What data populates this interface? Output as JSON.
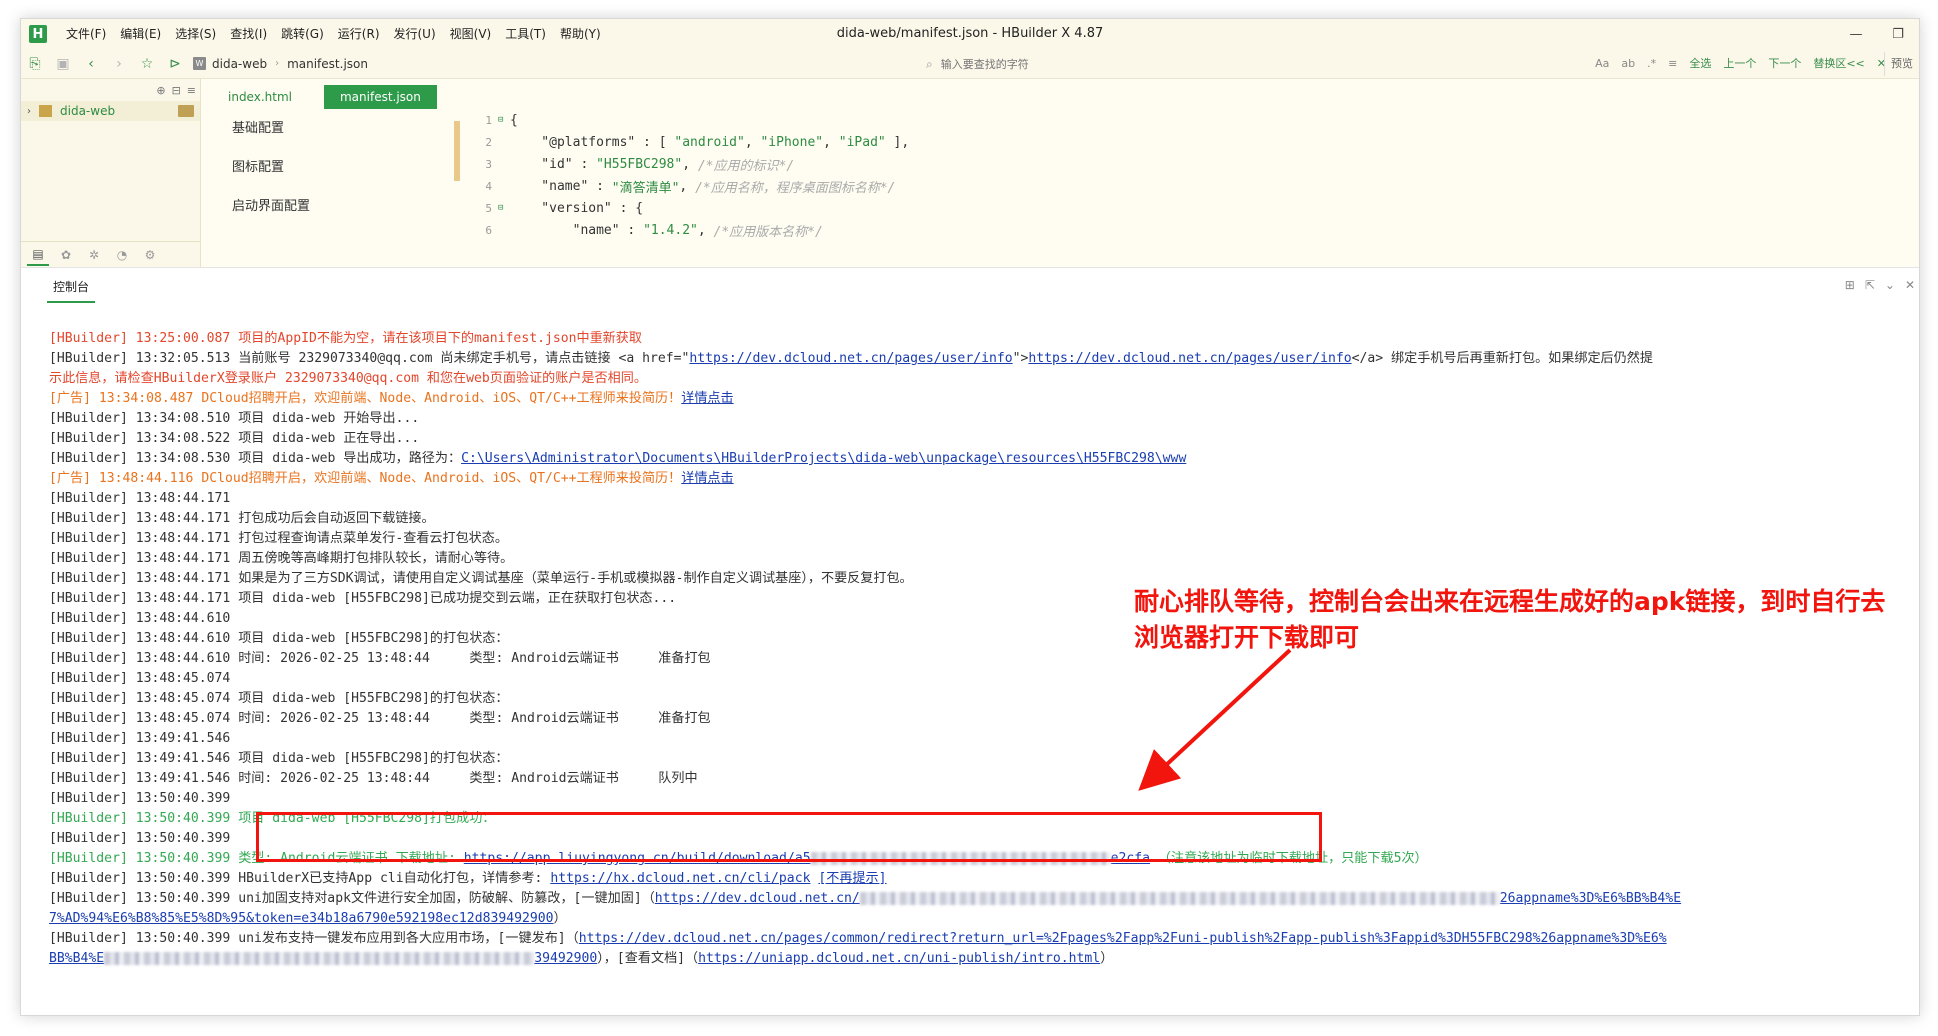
{
  "app": {
    "logo": "H",
    "title": "dida-web/manifest.json - HBuilder X 4.87",
    "menu": [
      "文件(F)",
      "编辑(E)",
      "选择(S)",
      "查找(I)",
      "跳转(G)",
      "运行(R)",
      "发行(U)",
      "视图(V)",
      "工具(T)",
      "帮助(Y)"
    ],
    "controls": {
      "minimize": "—",
      "restore": "❐"
    }
  },
  "toolbar": {
    "breadcrumb": [
      "dida-web",
      "manifest.json"
    ],
    "search_placeholder": "输入要查找的字符",
    "find_tools": [
      "Aa",
      "ab",
      ".*",
      "≡",
      "全选",
      "上一个",
      "下一个",
      "替换区<<",
      "✕"
    ],
    "preview": "预览"
  },
  "project": {
    "root": "dida-web"
  },
  "editor": {
    "tabs": [
      {
        "label": "index.html",
        "active": false
      },
      {
        "label": "manifest.json",
        "active": true
      }
    ],
    "config_nav": [
      "基础配置",
      "图标配置",
      "启动界面配置"
    ],
    "code_lines": [
      {
        "n": "1",
        "fold": "⊟",
        "parts": [
          {
            "t": "{",
            "c": "k"
          }
        ]
      },
      {
        "n": "2",
        "fold": "",
        "parts": [
          {
            "t": "    \"@platforms\" : [ ",
            "c": "k"
          },
          {
            "t": "\"android\"",
            "c": "s"
          },
          {
            "t": ", ",
            "c": "k"
          },
          {
            "t": "\"iPhone\"",
            "c": "s"
          },
          {
            "t": ", ",
            "c": "k"
          },
          {
            "t": "\"iPad\"",
            "c": "s"
          },
          {
            "t": " ],",
            "c": "k"
          }
        ]
      },
      {
        "n": "3",
        "fold": "",
        "parts": [
          {
            "t": "    \"id\" : ",
            "c": "k"
          },
          {
            "t": "\"H55FBC298\"",
            "c": "s"
          },
          {
            "t": ", ",
            "c": "k"
          },
          {
            "t": "/*应用的标识*/",
            "c": "c"
          }
        ]
      },
      {
        "n": "4",
        "fold": "",
        "parts": [
          {
            "t": "    \"name\" : ",
            "c": "k"
          },
          {
            "t": "\"滴答清单\"",
            "c": "s"
          },
          {
            "t": ", ",
            "c": "k"
          },
          {
            "t": "/*应用名称，程序桌面图标名称*/",
            "c": "c"
          }
        ]
      },
      {
        "n": "5",
        "fold": "⊟",
        "parts": [
          {
            "t": "    \"version\" : {",
            "c": "k"
          }
        ]
      },
      {
        "n": "6",
        "fold": "",
        "parts": [
          {
            "t": "        \"name\" : ",
            "c": "k"
          },
          {
            "t": "\"1.4.2\"",
            "c": "s"
          },
          {
            "t": ", ",
            "c": "k"
          },
          {
            "t": "/*应用版本名称*/",
            "c": "c"
          }
        ]
      }
    ]
  },
  "console": {
    "tab": "控制台",
    "lines": [
      {
        "cls": "red",
        "parts": [
          {
            "t": "[HBuilder] 13:25:00.087 项目的AppID不能为空，请在该项目下的manifest.json中重新获取"
          }
        ]
      },
      {
        "cls": "",
        "parts": [
          {
            "t": "[HBuilder] 13:32:05.513 "
          },
          {
            "t": "当前账号 2329073340@qq.com 尚未绑定手机号，请点击链接 <a href=\"",
            "cls": "red"
          },
          {
            "t": "https://dev.dcloud.net.cn/pages/user/info",
            "link": true
          },
          {
            "t": "\">",
            "cls": "red"
          },
          {
            "t": "https://dev.dcloud.net.cn/pages/user/info",
            "link": true
          },
          {
            "t": "</a> 绑定手机号后再重新打包。如果绑定后仍然提",
            "cls": "red"
          }
        ]
      },
      {
        "cls": "red",
        "parts": [
          {
            "t": "示此信息，请检查HBuilderX登录账户 2329073340@qq.com 和您在web页面验证的账户是否相同。"
          }
        ]
      },
      {
        "cls": "orange",
        "parts": [
          {
            "t": "[广告] 13:34:08.487 DCloud招聘开启，欢迎前端、Node、Android、iOS、QT/C++工程师来投简历！"
          },
          {
            "t": "详情点击",
            "link": true
          }
        ]
      },
      {
        "cls": "",
        "parts": [
          {
            "t": "[HBuilder] 13:34:08.510 项目 dida-web 开始导出..."
          }
        ]
      },
      {
        "cls": "",
        "parts": [
          {
            "t": "[HBuilder] 13:34:08.522 项目 dida-web 正在导出..."
          }
        ]
      },
      {
        "cls": "",
        "parts": [
          {
            "t": "[HBuilder] 13:34:08.530 "
          },
          {
            "t": "项目 dida-web 导出成功，路径为：",
            "cls": "orange"
          },
          {
            "t": "C:\\Users\\Administrator\\Documents\\HBuilderProjects\\dida-web\\unpackage\\resources\\H55FBC298\\www",
            "link": true
          }
        ]
      },
      {
        "cls": "orange",
        "parts": [
          {
            "t": "[广告] 13:48:44.116 DCloud招聘开启，欢迎前端、Node、Android、iOS、QT/C++工程师来投简历！"
          },
          {
            "t": "详情点击",
            "link": true
          }
        ]
      },
      {
        "cls": "",
        "parts": [
          {
            "t": "[HBuilder] 13:48:44.171"
          }
        ]
      },
      {
        "cls": "",
        "parts": [
          {
            "t": "[HBuilder] 13:48:44.171 打包成功后会自动返回下载链接。"
          }
        ]
      },
      {
        "cls": "",
        "parts": [
          {
            "t": "[HBuilder] 13:48:44.171 打包过程查询请点菜单发行-查看云打包状态。"
          }
        ]
      },
      {
        "cls": "",
        "parts": [
          {
            "t": "[HBuilder] 13:48:44.171 周五傍晚等高峰期打包排队较长，请耐心等待。"
          }
        ]
      },
      {
        "cls": "",
        "parts": [
          {
            "t": "[HBuilder] 13:48:44.171 如果是为了三方SDK调试，请使用自定义调试基座（菜单运行-手机或模拟器-制作自定义调试基座），不要反复打包。"
          }
        ]
      },
      {
        "cls": "",
        "parts": [
          {
            "t": "[HBuilder] 13:48:44.171 项目 dida-web [H55FBC298]已成功提交到云端，正在获取打包状态..."
          }
        ]
      },
      {
        "cls": "",
        "parts": [
          {
            "t": "[HBuilder] 13:48:44.610"
          }
        ]
      },
      {
        "cls": "",
        "parts": [
          {
            "t": "[HBuilder] 13:48:44.610 项目 dida-web [H55FBC298]的打包状态："
          }
        ]
      },
      {
        "cls": "",
        "parts": [
          {
            "t": "[HBuilder] 13:48:44.610 时间: 2026-02-25 13:48:44     类型: Android云端证书     准备打包"
          }
        ]
      },
      {
        "cls": "",
        "parts": [
          {
            "t": "[HBuilder] 13:48:45.074"
          }
        ]
      },
      {
        "cls": "",
        "parts": [
          {
            "t": "[HBuilder] 13:48:45.074 项目 dida-web [H55FBC298]的打包状态："
          }
        ]
      },
      {
        "cls": "",
        "parts": [
          {
            "t": "[HBuilder] 13:48:45.074 时间: 2026-02-25 13:48:44     类型: Android云端证书     准备打包"
          }
        ]
      },
      {
        "cls": "",
        "parts": [
          {
            "t": "[HBuilder] 13:49:41.546"
          }
        ]
      },
      {
        "cls": "",
        "parts": [
          {
            "t": "[HBuilder] 13:49:41.546 项目 dida-web [H55FBC298]的打包状态："
          }
        ]
      },
      {
        "cls": "",
        "parts": [
          {
            "t": "[HBuilder] 13:49:41.546 时间: 2026-02-25 13:48:44     类型: Android云端证书     队列中"
          }
        ]
      },
      {
        "cls": "",
        "parts": [
          {
            "t": "[HBuilder] 13:50:40.399"
          }
        ]
      },
      {
        "cls": "green",
        "parts": [
          {
            "t": "[HBuilder] 13:50:40.399 项目 dida-web [H55FBC298]打包成功："
          }
        ]
      },
      {
        "cls": "",
        "parts": [
          {
            "t": "[HBuilder] 13:50:40.399"
          }
        ]
      },
      {
        "cls": "green",
        "parts": [
          {
            "t": "[HBuilder] 13:50:40.399 类型: Android云端证书 下载地址: "
          },
          {
            "t": "https://app.liuyingyong.cn/build/download/a5",
            "link": true
          },
          {
            "blur": 300
          },
          {
            "t": "e2cfa",
            "link": true
          },
          {
            "t": " （注意该地址为临时下载地址，只能下载5次）"
          }
        ]
      },
      {
        "cls": "",
        "parts": [
          {
            "t": "[HBuilder] 13:50:40.399 HBuilderX已支持App cli自动化打包，详情参考: "
          },
          {
            "t": "https://hx.dcloud.net.cn/cli/pack",
            "link": true
          },
          {
            "t": " "
          },
          {
            "t": "[不再提示]",
            "link": true
          }
        ]
      },
      {
        "cls": "",
        "parts": [
          {
            "t": "[HBuilder] 13:50:40.399 uni加固支持对apk文件进行安全加固，防破解、防篡改，[一键加固]（"
          },
          {
            "t": "https://dev.dcloud.net.cn/",
            "link": true
          },
          {
            "blur": 640
          },
          {
            "t": "26appname%3D%E6%BB%B4%E",
            "link": true
          }
        ]
      },
      {
        "cls": "",
        "parts": [
          {
            "t": "7%AD%94%E6%B8%85%E5%8D%95&token=e34b18a6790e592198ec12d839492900",
            "link": true
          },
          {
            "t": "）"
          }
        ]
      },
      {
        "cls": "",
        "parts": [
          {
            "t": "[HBuilder] 13:50:40.399 uni发布支持一键发布应用到各大应用市场，[一键发布]（"
          },
          {
            "t": "https://dev.dcloud.net.cn/pages/common/redirect?return_url=%2Fpages%2Fapp%2Funi-publish%2Fapp-publish%3Fappid%3DH55FBC298%26appname%3D%E6%",
            "link": true
          }
        ]
      },
      {
        "cls": "",
        "parts": [
          {
            "t": "BB%B4%E",
            "link": true
          },
          {
            "blur": 430
          },
          {
            "t": "39492900",
            "link": true
          },
          {
            "t": "），[查看文档]（"
          },
          {
            "t": "https://uniapp.dcloud.net.cn/uni-publish/intro.html",
            "link": true
          },
          {
            "t": "）"
          }
        ]
      }
    ]
  },
  "annotation": {
    "text": "耐心排队等待，控制台会出来在远程生成好的apk链接，到时自行去浏览器打开下载即可",
    "color": "#f2150e"
  },
  "colors": {
    "accent": "#2e9b4a",
    "error": "#e2472c",
    "ad": "#e9731d",
    "success": "#32a852",
    "link": "#1a3db0"
  }
}
